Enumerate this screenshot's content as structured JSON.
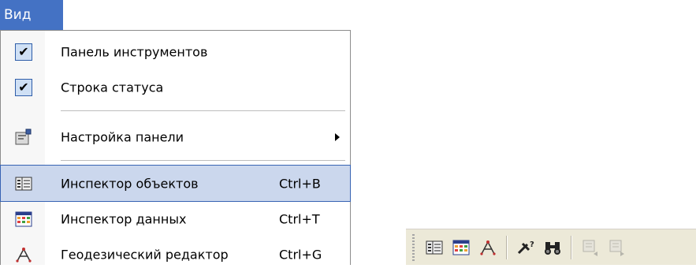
{
  "menu": {
    "title": "Вид",
    "items": [
      {
        "label": "Панель инструментов",
        "checked": true
      },
      {
        "label": "Строка статуса",
        "checked": true
      },
      {
        "label": "Настройка панели",
        "submenu": true,
        "icon": "toolbar-settings-icon"
      },
      {
        "label": "Инспектор объектов",
        "shortcut": "Ctrl+B",
        "icon": "object-inspector-icon",
        "highlighted": true
      },
      {
        "label": "Инспектор данных",
        "shortcut": "Ctrl+T",
        "icon": "data-inspector-icon"
      },
      {
        "label": "Геодезический редактор",
        "shortcut": "Ctrl+G",
        "icon": "geodesic-editor-icon"
      }
    ]
  },
  "toolbar": {
    "buttons": [
      {
        "icon": "object-inspector-icon"
      },
      {
        "icon": "data-inspector-icon"
      },
      {
        "icon": "geodesic-editor-icon"
      },
      {
        "icon": "measure-tool-icon"
      },
      {
        "icon": "binoculars-icon"
      },
      {
        "icon": "nav-back-icon",
        "disabled": true
      },
      {
        "icon": "nav-forward-icon",
        "disabled": true
      }
    ]
  },
  "colors": {
    "menu_title_bg": "#4472c4",
    "highlight_bg": "#cbd7ed",
    "highlight_border": "#3763b3",
    "check_bg": "#cfe0f5",
    "toolbar_bg": "#ece9d8"
  }
}
